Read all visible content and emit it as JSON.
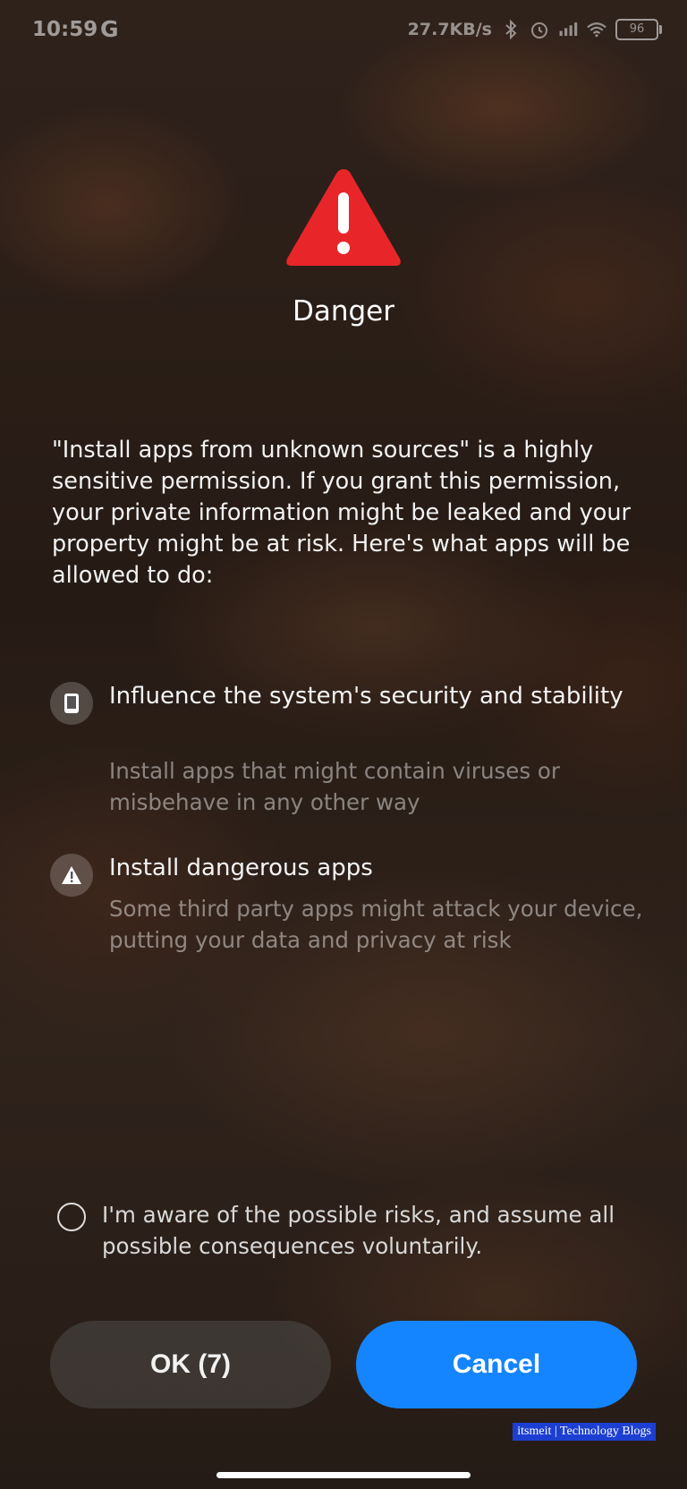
{
  "status_bar": {
    "time": "10:59",
    "carrier_icon_label": "G",
    "net_speed": "27.7KB/s",
    "battery": "96",
    "icons": [
      "bluetooth-icon",
      "alarm-icon",
      "signal-icon",
      "wifi-icon",
      "battery-icon"
    ]
  },
  "header": {
    "icon": "warning-triangle-icon",
    "icon_color": "#e8262a",
    "title": "Danger"
  },
  "intro": "\"Install apps from unknown sources\" is a highly sensitive permission. If you grant this permission, your private information might be leaked and your property might be at risk. Here's what apps will be allowed to do:",
  "permissions": [
    {
      "icon": "phone-icon",
      "title": "Influence the system's security and stability",
      "description": "Install apps that might contain viruses or misbehave in any other way"
    },
    {
      "icon": "warning-icon",
      "title": "Install dangerous apps",
      "description": "Some third party apps might attack your device, putting your data and privacy at risk"
    }
  ],
  "agreement": {
    "checked": false,
    "text": "I'm aware of the possible risks, and assume all possible consequences voluntarily."
  },
  "buttons": {
    "ok": "OK (7)",
    "cancel": "Cancel",
    "cancel_color": "#1585ff"
  },
  "watermark": "itsmeit | Technology Blogs"
}
